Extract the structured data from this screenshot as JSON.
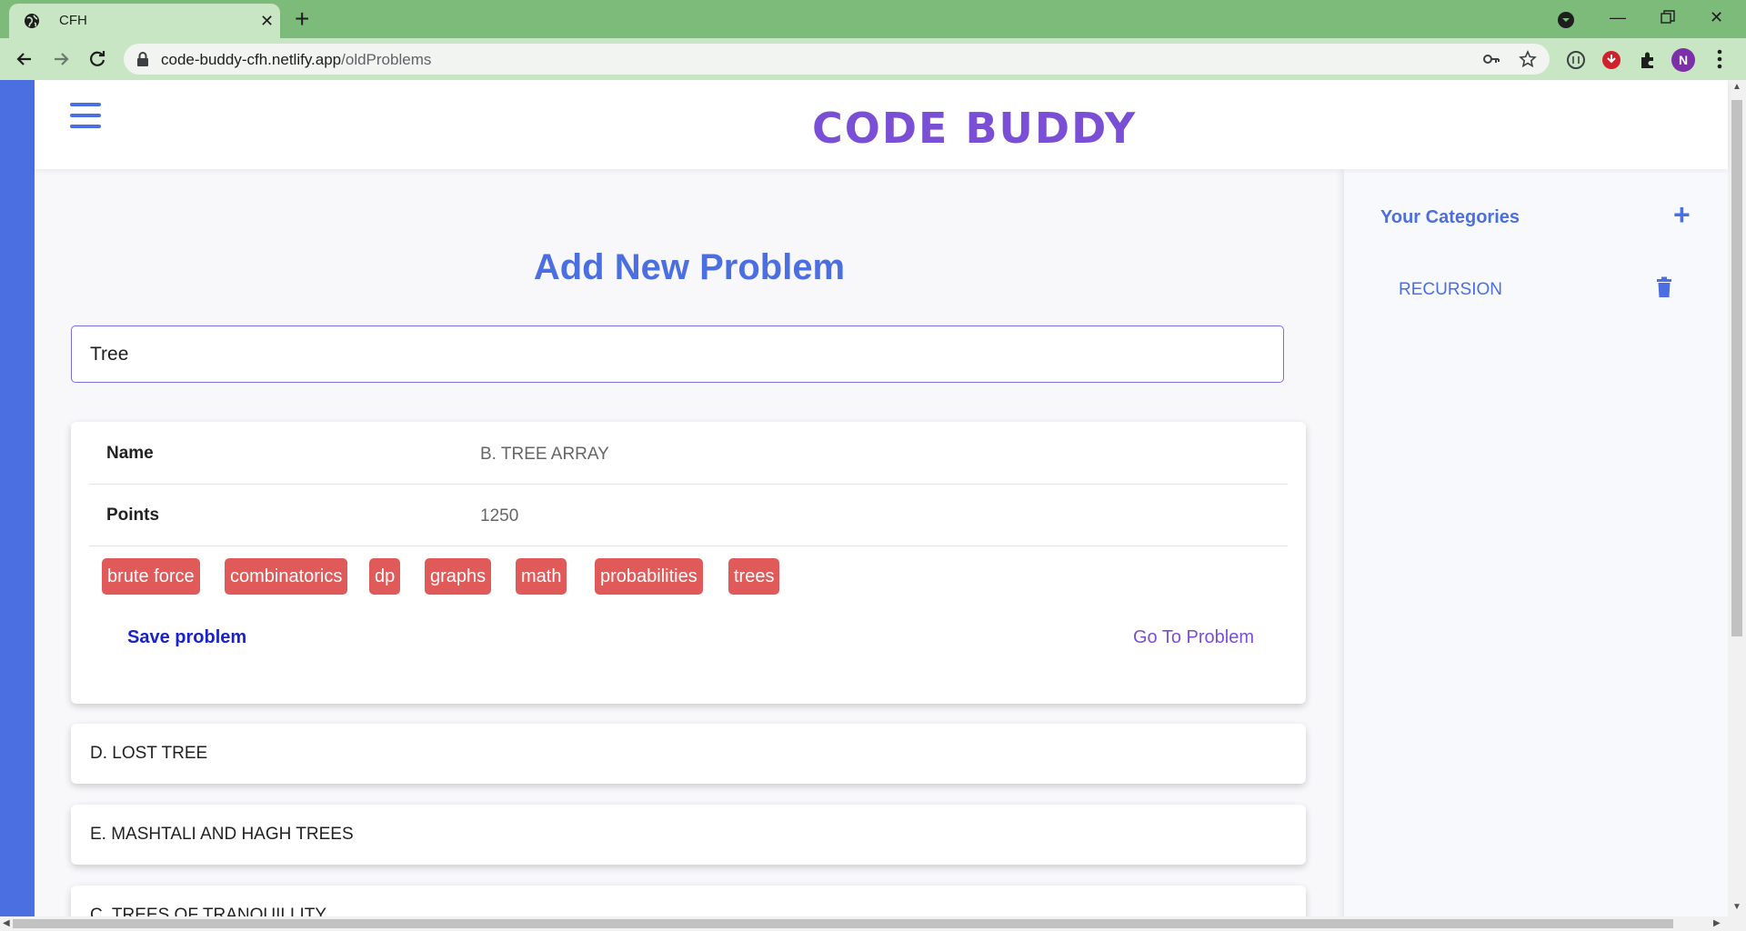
{
  "browser": {
    "tab_title": "CFH",
    "url_host": "code-buddy-cfh.netlify.app",
    "url_path": "/oldProblems",
    "profile_initial": "N"
  },
  "header": {
    "brand": "CODE BUDDY"
  },
  "main": {
    "title": "Add New Problem",
    "search_value": "Tree",
    "expanded_problem": {
      "name_label": "Name",
      "name_value": "B. TREE ARRAY",
      "points_label": "Points",
      "points_value": "1250",
      "tags": [
        "brute force",
        "combinatorics",
        "dp",
        "graphs",
        "math",
        "probabilities",
        "trees"
      ],
      "save_label": "Save problem",
      "goto_label": "Go To Problem"
    },
    "problems": [
      "D. LOST TREE",
      "E. MASHTALI AND HAGH TREES",
      "C. TREES OF TRANQUILLITY"
    ]
  },
  "sidebar": {
    "title": "Your Categories",
    "add_icon": "plus-icon",
    "categories": [
      {
        "label": "RECURSION",
        "icon": "trash-icon"
      }
    ]
  },
  "colors": {
    "accent_blue": "#4b6fe0",
    "brand_purple": "#7a4fd6",
    "tag_red": "#e05a5a",
    "save_link": "#1a22cc",
    "chrome_green": "#7dbb7a"
  }
}
